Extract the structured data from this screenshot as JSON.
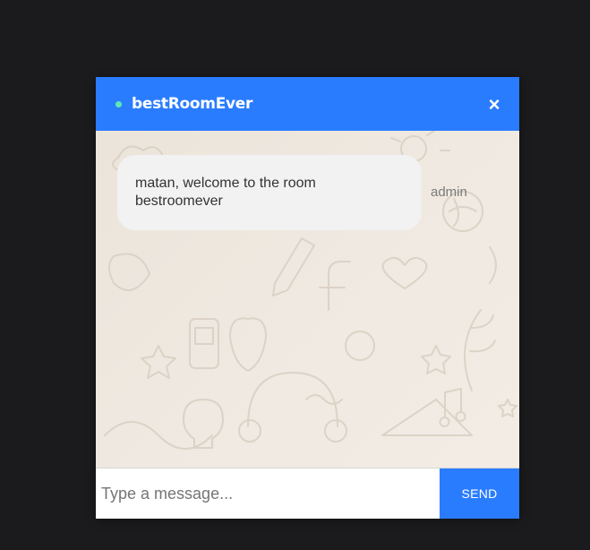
{
  "colors": {
    "page_background": "#1b1b1d",
    "header_accent": "#2a7cff",
    "online_indicator": "#5ee8b4",
    "bubble_background": "#f2f2f2",
    "chat_background": "#efe7dc"
  },
  "header": {
    "room_name": "bestRoomEver",
    "status_icon": "online-dot-icon",
    "close_label": "×",
    "close_icon": "close-icon"
  },
  "messages": [
    {
      "text": "matan, welcome to the room bestroomever",
      "sender": "admin"
    }
  ],
  "composer": {
    "placeholder": "Type a message...",
    "value": "",
    "send_label": "SEND"
  }
}
